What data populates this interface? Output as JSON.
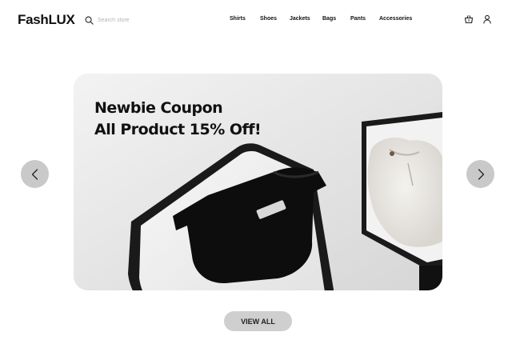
{
  "header": {
    "brand": "FashLUX",
    "search": {
      "placeholder": "Search store",
      "icon": "search-icon"
    },
    "nav": [
      "Shirts",
      "Shoes",
      "Jackets",
      "Bags",
      "Pants",
      "Accessories"
    ],
    "icons": [
      "basket-icon",
      "user-icon"
    ]
  },
  "hero": {
    "line1": "Newbie Coupon",
    "line2": "All Product 15% Off!",
    "prev_icon": "chevron-left-icon",
    "next_icon": "chevron-right-icon"
  },
  "cta": {
    "label": "VIEW ALL"
  }
}
